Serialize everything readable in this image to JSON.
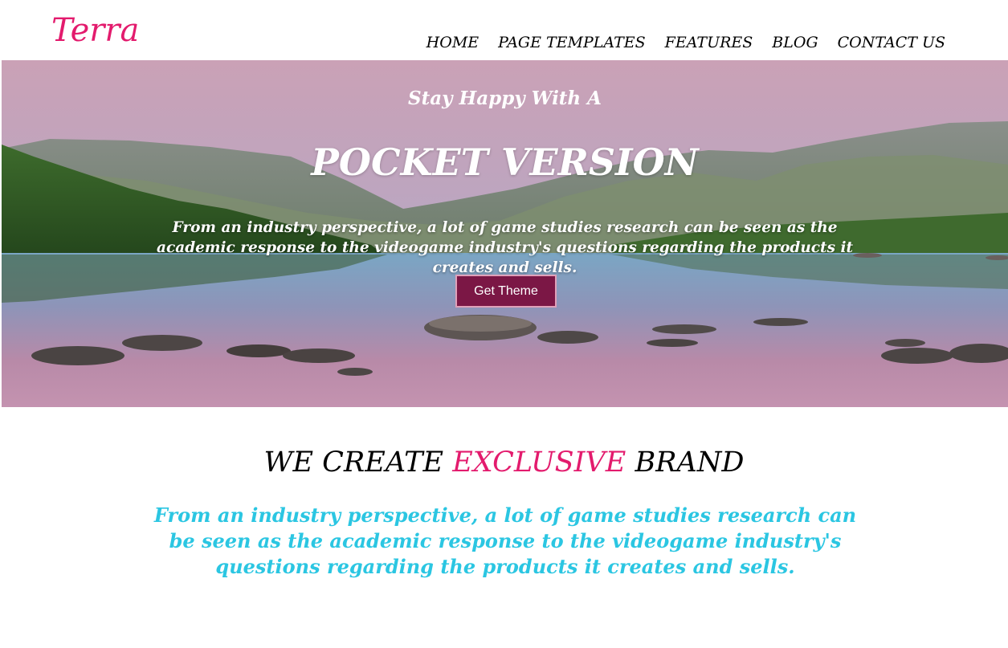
{
  "header": {
    "logo": "Terra",
    "nav": [
      {
        "label": "HOME"
      },
      {
        "label": "PAGE TEMPLATES"
      },
      {
        "label": "FEATURES"
      },
      {
        "label": "BLOG"
      },
      {
        "label": "CONTACT US"
      }
    ]
  },
  "hero": {
    "subtitle": "Stay Happy With A",
    "title": "POCKET VERSION",
    "description": "From an industry perspective, a lot of game studies research can be seen as the academic response to the videogame industry's questions regarding the products it creates and sells.",
    "button_label": "Get Theme"
  },
  "brand_section": {
    "heading_before": "WE CREATE",
    "heading_accent": "EXCLUSIVE",
    "heading_after": "BRAND",
    "description": "From an industry perspective, a lot of game studies research can be seen as the academic response to the videogame industry's questions regarding the products it creates and sells."
  },
  "colors": {
    "brand_pink": "#e31b6d",
    "button_bg": "#7b1745",
    "cyan_text": "#2bc6e2"
  }
}
